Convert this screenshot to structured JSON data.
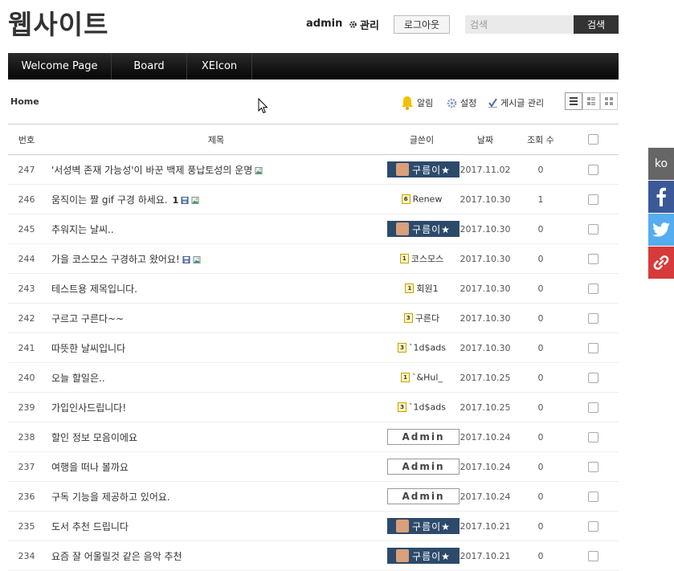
{
  "header": {
    "site_title": "웹사이트",
    "user_name": "admin",
    "admin_label": "관리",
    "logout_label": "로그아웃",
    "search_placeholder": "검색",
    "search_button": "검색"
  },
  "nav": {
    "items": [
      {
        "label": "Welcome Page"
      },
      {
        "label": "Board"
      },
      {
        "label": "XEIcon"
      }
    ]
  },
  "breadcrumb": "Home",
  "toolbar": {
    "notify_label": "알림",
    "settings_label": "설정",
    "manage_label": "게시글 관리"
  },
  "table": {
    "headers": {
      "no": "번호",
      "title": "제목",
      "author": "글쓴이",
      "date": "날짜",
      "views": "조회 수"
    },
    "rows": [
      {
        "no": "247",
        "title": "'서성벽 존재 가능성'이 바꾼 백제 풍납토성의 운명",
        "comments": "",
        "files": [
          "image"
        ],
        "author_type": "badge",
        "author": "구름이★",
        "date": "2017.11.02",
        "views": "0"
      },
      {
        "no": "246",
        "title": "움직이는 짤 gif 구경 하세요.",
        "comments": "1",
        "files": [
          "disk",
          "image"
        ],
        "author_type": "level",
        "level": "6",
        "author": "Renew",
        "date": "2017.10.30",
        "views": "1"
      },
      {
        "no": "245",
        "title": "추워지는 날씨..",
        "comments": "",
        "files": [],
        "author_type": "badge",
        "author": "구름이★",
        "date": "2017.10.30",
        "views": "0"
      },
      {
        "no": "244",
        "title": "가을 코스모스 구경하고 왔어요!",
        "comments": "",
        "files": [
          "disk",
          "image"
        ],
        "author_type": "level",
        "level": "1",
        "author": "코스모스",
        "date": "2017.10.30",
        "views": "0"
      },
      {
        "no": "243",
        "title": "테스트용 제목입니다.",
        "comments": "",
        "files": [],
        "author_type": "level",
        "level": "1",
        "author": "회원1",
        "date": "2017.10.30",
        "views": "0"
      },
      {
        "no": "242",
        "title": "구르고 구른다~~",
        "comments": "",
        "files": [],
        "author_type": "level",
        "level": "3",
        "author": "구른다",
        "date": "2017.10.30",
        "views": "0"
      },
      {
        "no": "241",
        "title": "따뜻한 날씨입니다",
        "comments": "",
        "files": [],
        "author_type": "level",
        "level": "3",
        "author": "`1d$ads",
        "date": "2017.10.30",
        "views": "0"
      },
      {
        "no": "240",
        "title": "오늘 할일은..",
        "comments": "",
        "files": [],
        "author_type": "level",
        "level": "1",
        "author": "`&Hul_",
        "date": "2017.10.25",
        "views": "0"
      },
      {
        "no": "239",
        "title": "가입인사드립니다!",
        "comments": "",
        "files": [],
        "author_type": "level",
        "level": "3",
        "author": "`1d$ads",
        "date": "2017.10.25",
        "views": "0"
      },
      {
        "no": "238",
        "title": "할인 정보 모음이에요",
        "comments": "",
        "files": [],
        "author_type": "admin",
        "author": "Admin",
        "date": "2017.10.24",
        "views": "0"
      },
      {
        "no": "237",
        "title": "여행을 떠나 볼까요",
        "comments": "",
        "files": [],
        "author_type": "admin",
        "author": "Admin",
        "date": "2017.10.24",
        "views": "0"
      },
      {
        "no": "236",
        "title": "구독 기능을 제공하고 있어요.",
        "comments": "",
        "files": [],
        "author_type": "admin",
        "author": "Admin",
        "date": "2017.10.24",
        "views": "0"
      },
      {
        "no": "235",
        "title": "도서 추천 드립니다",
        "comments": "",
        "files": [],
        "author_type": "badge",
        "author": "구름이★",
        "date": "2017.10.21",
        "views": "0"
      },
      {
        "no": "234",
        "title": "요즘 잘 어울릴것 같은 음악 추천",
        "comments": "",
        "files": [],
        "author_type": "badge",
        "author": "구름이★",
        "date": "2017.10.21",
        "views": "0"
      }
    ]
  },
  "share": {
    "lang_label": "ko",
    "icons": [
      "facebook-icon",
      "twitter-icon",
      "link-icon"
    ]
  },
  "colors": {
    "nav_bg": "#111111",
    "badge_bg": "#2d4a6b",
    "facebook": "#3b5998",
    "twitter": "#55acee",
    "link": "#d63a3a"
  }
}
